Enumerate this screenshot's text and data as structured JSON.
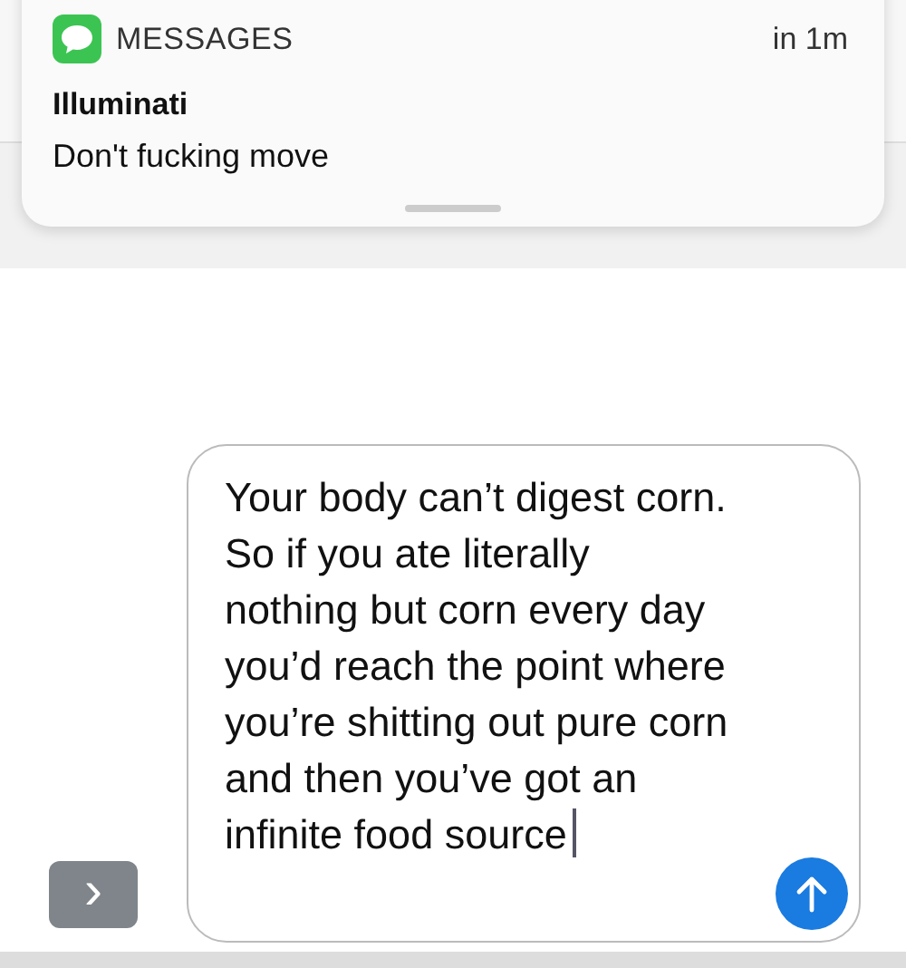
{
  "notification": {
    "app": "MESSAGES",
    "time": "in 1m",
    "sender": "Illuminati",
    "message": "Don't fucking move"
  },
  "compose": {
    "text": "Your body can’t digest corn. So if you ate literally nothing but corn every day you’d reach the point where you’re shitting out pure corn and then you’ve got an infinite food source",
    "expand_button": "›"
  }
}
